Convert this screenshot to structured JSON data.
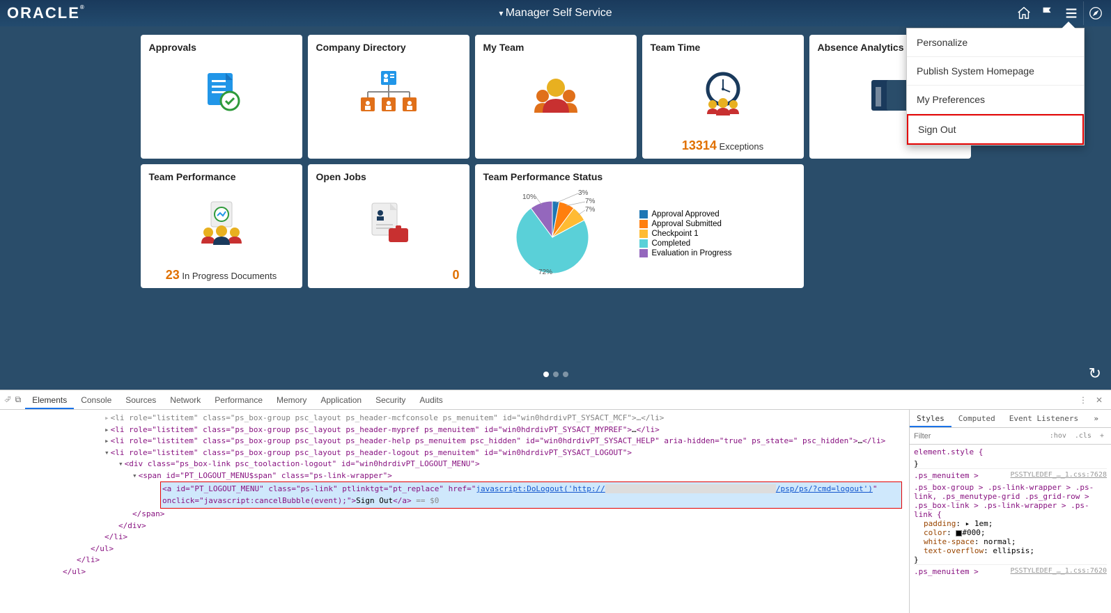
{
  "header": {
    "logo": "ORACLE",
    "title": "Manager Self Service"
  },
  "menu": {
    "items": [
      {
        "label": "Personalize"
      },
      {
        "label": "Publish System Homepage"
      },
      {
        "label": "My Preferences"
      },
      {
        "label": "Sign Out"
      }
    ]
  },
  "tiles": {
    "approvals": {
      "title": "Approvals"
    },
    "directory": {
      "title": "Company Directory"
    },
    "myteam": {
      "title": "My Team"
    },
    "teamtime": {
      "title": "Team Time",
      "count": "13314",
      "count_label": "Exceptions"
    },
    "absence": {
      "title": "Absence Analytics"
    },
    "perf": {
      "title": "Team Performance",
      "count": "23",
      "count_label": "In Progress Documents"
    },
    "openjobs": {
      "title": "Open Jobs",
      "count": "0"
    },
    "status": {
      "title": "Team Performance Status"
    }
  },
  "chart_data": {
    "type": "pie",
    "title": "Team Performance Status",
    "series": [
      {
        "name": "Approval Approved",
        "value": 3,
        "label": "3%",
        "color": "#1f77b4"
      },
      {
        "name": "Approval Submitted",
        "value": 7,
        "label": "7%",
        "color": "#ff7f0e"
      },
      {
        "name": "Checkpoint 1",
        "value": 7,
        "label": "7%",
        "color": "#ffbb33"
      },
      {
        "name": "Completed",
        "value": 72,
        "label": "72%",
        "color": "#5ad0d8"
      },
      {
        "name": "Evaluation in Progress",
        "value": 10,
        "label": "10%",
        "color": "#9467bd"
      }
    ]
  },
  "devtools": {
    "tabs": [
      "Elements",
      "Console",
      "Sources",
      "Network",
      "Performance",
      "Memory",
      "Application",
      "Security",
      "Audits"
    ],
    "lines": {
      "l0": "<li role=\"listitem\" class=\"ps_box-group psc_layout ps_header-mcfconsole ps_menuitem\" id=\"win0hdrdivPT_SYSACT_MCF\">…</li>",
      "l1_pre": "<li role=\"listitem\" class=\"ps_box-group psc_layout ps_header-mypref ps_menuitem\" id=\"win0hdrdivPT_SYSACT_MYPREF\">",
      "l1_text": "…",
      "l1_post": "</li>",
      "l2_pre": "<li role=\"listitem\" class=\"ps_box-group psc_layout ps_header-help ps_menuitem psc_hidden\" id=\"win0hdrdivPT_SYSACT_HELP\" aria-hidden=\"true\" ps_state=\" psc_hidden\">",
      "l2_text": "…",
      "l2_post": "</li>",
      "l3": "<li role=\"listitem\" class=\"ps_box-group psc_layout ps_header-logout ps_menuitem\" id=\"win0hdrdivPT_SYSACT_LOGOUT\">",
      "l4": "<div class=\"ps_box-link psc_toolaction-logout\" id=\"win0hdrdivPT_LOGOUT_MENU\">",
      "l5": "<span id=\"PT_LOGOUT_MENU$span\" class=\"ps-link-wrapper\">",
      "hl_a_open": "<a id=\"PT_LOGOUT_MENU\" class=\"ps-link\" ptlinktgt=\"pt_replace\" href=\"",
      "hl_href_text": "javascript:DoLogout('http://",
      "hl_href_tail": "/psp/ps/?cmd=logout')",
      "hl_onclick": "\" onclick=\"javascript:cancelBubble(event);\">",
      "hl_linktext": "Sign Out",
      "hl_close": "</a>",
      "hl_eq": " == $0",
      "c_span": "</span>",
      "c_div": "</div>",
      "c_li": "</li>",
      "c_ul": "</ul>"
    },
    "styles_tabs": [
      "Styles",
      "Computed",
      "Event Listeners"
    ],
    "filter_placeholder": "Filter",
    "hov": ":hov",
    "cls": ".cls",
    "rules": {
      "r0_sel": "element.style {",
      "r1_sel": ".ps_menuitem >",
      "r1_src": "PSSTYLEDEF_…_1.css:7628",
      "r2_sel": ".ps_box-group > .ps-link-wrapper > .ps-link, .ps_menutype-grid .ps_grid-row > .ps_box-link > .ps-link-wrapper > .ps-link {",
      "p_padding": "padding: ▸ 1em;",
      "p_color": "color: ■#000;",
      "p_ws": "white-space: normal;",
      "p_to": "text-overflow: ellipsis;",
      "r3_sel": ".ps_menuitem >",
      "r3_src": "PSSTYLEDEF_…_1.css:7620"
    }
  }
}
